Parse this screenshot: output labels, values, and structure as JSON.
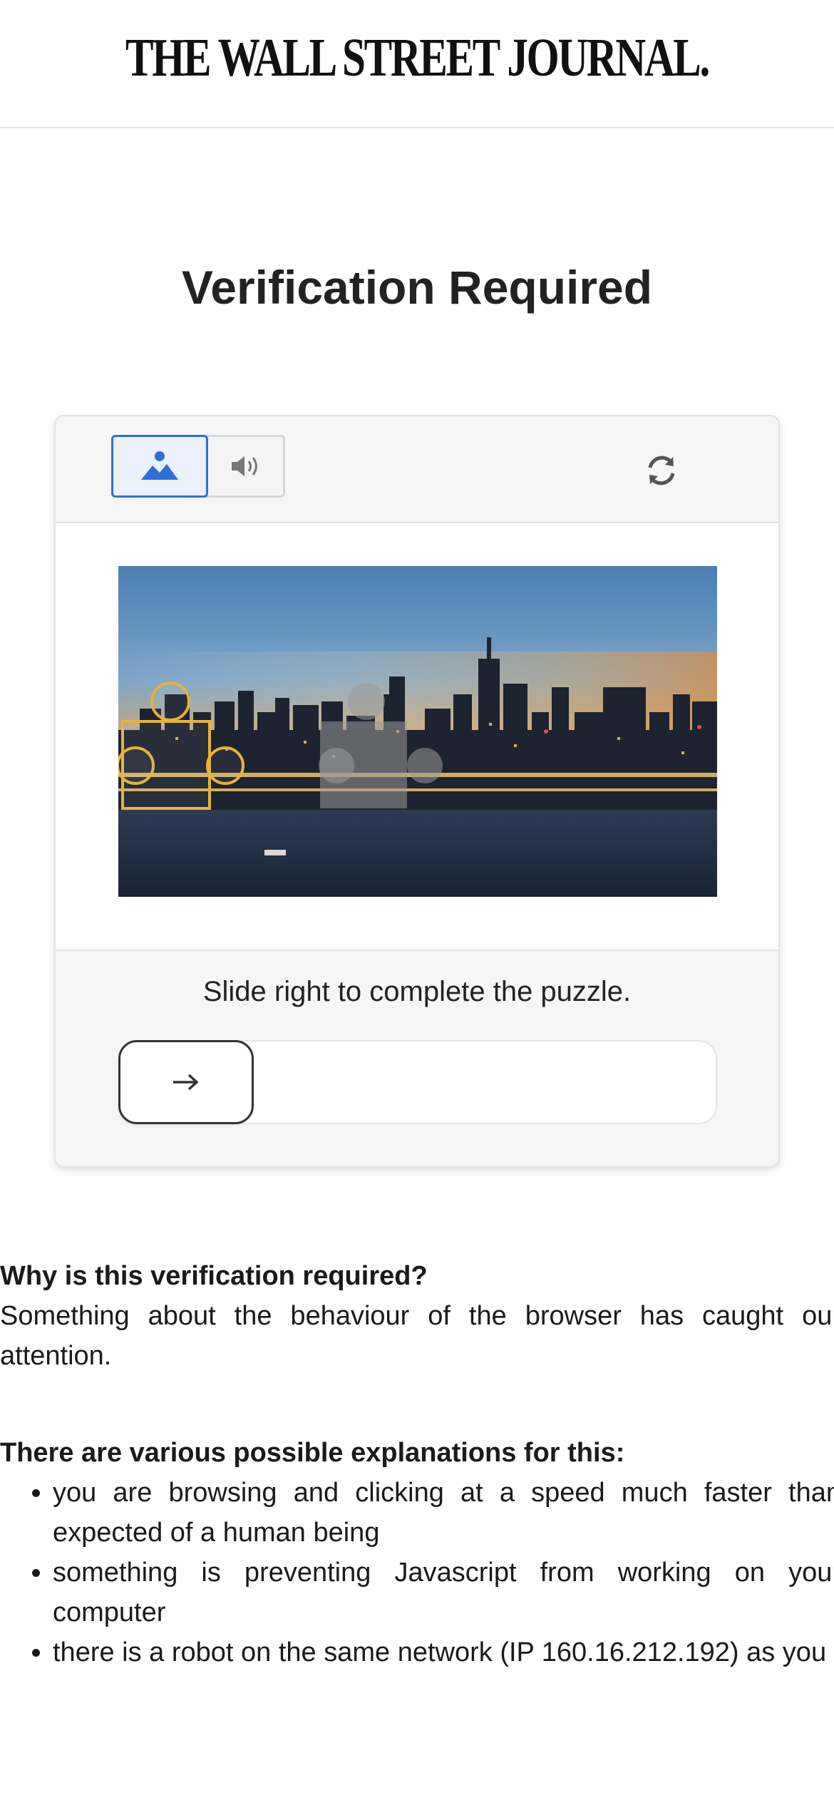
{
  "header": {
    "logo_text": "THE WALL STREET JOURNAL."
  },
  "page": {
    "title": "Verification Required"
  },
  "captcha": {
    "modes": [
      {
        "name": "image",
        "icon": "image-icon",
        "selected": true
      },
      {
        "name": "audio",
        "icon": "speaker-icon",
        "selected": false
      }
    ],
    "refresh_icon": "refresh-icon",
    "puzzle_image": "city-skyline-at-dusk-with-puzzle-piece",
    "instruction": "Slide right to complete the puzzle.",
    "slider_icon": "arrow-right-icon",
    "slider_progress": 0,
    "accent_color": "#2f6fd6",
    "piece_outline_color": "#e8b23a"
  },
  "info": {
    "why_heading": "Why is this verification required?",
    "why_text": "Something about the behaviour of the browser has caught our attention.",
    "explanations_heading": "There are various possible explanations for this:",
    "explanations": [
      "you are browsing and clicking at a speed much faster than expected of a human being",
      "something is preventing Javascript from working on your computer",
      "there is a robot on the same network (IP 160.16.212.192) as you"
    ]
  }
}
